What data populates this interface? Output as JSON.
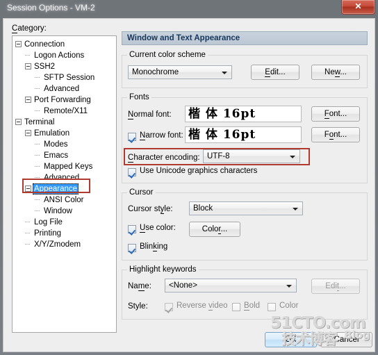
{
  "window": {
    "title": "Session Options - VM-2",
    "close_glyph": "✕"
  },
  "category": {
    "label": "Category:",
    "tree": [
      {
        "text": "Connection",
        "depth": 0,
        "expander": true,
        "selected": false
      },
      {
        "text": "Logon Actions",
        "depth": 1,
        "expander": false,
        "selected": false
      },
      {
        "text": "SSH2",
        "depth": 1,
        "expander": true,
        "selected": false
      },
      {
        "text": "SFTP Session",
        "depth": 2,
        "expander": false,
        "selected": false
      },
      {
        "text": "Advanced",
        "depth": 2,
        "expander": false,
        "selected": false
      },
      {
        "text": "Port Forwarding",
        "depth": 1,
        "expander": true,
        "selected": false
      },
      {
        "text": "Remote/X11",
        "depth": 2,
        "expander": false,
        "selected": false
      },
      {
        "text": "Terminal",
        "depth": 0,
        "expander": true,
        "selected": false
      },
      {
        "text": "Emulation",
        "depth": 1,
        "expander": true,
        "selected": false
      },
      {
        "text": "Modes",
        "depth": 2,
        "expander": false,
        "selected": false
      },
      {
        "text": "Emacs",
        "depth": 2,
        "expander": false,
        "selected": false
      },
      {
        "text": "Mapped Keys",
        "depth": 2,
        "expander": false,
        "selected": false
      },
      {
        "text": "Advanced",
        "depth": 2,
        "expander": false,
        "selected": false
      },
      {
        "text": "Appearance",
        "depth": 1,
        "expander": true,
        "selected": true
      },
      {
        "text": "ANSI Color",
        "depth": 2,
        "expander": false,
        "selected": false
      },
      {
        "text": "Window",
        "depth": 2,
        "expander": false,
        "selected": false
      },
      {
        "text": "Log File",
        "depth": 1,
        "expander": false,
        "selected": false
      },
      {
        "text": "Printing",
        "depth": 1,
        "expander": false,
        "selected": false
      },
      {
        "text": "X/Y/Zmodem",
        "depth": 1,
        "expander": false,
        "selected": false
      }
    ]
  },
  "pane": {
    "header": "Window and Text Appearance",
    "color_scheme": {
      "group_label": "Current color scheme",
      "value": "Monochrome",
      "edit_button": "Edit...",
      "new_button": "New..."
    },
    "fonts": {
      "group_label": "Fonts",
      "normal_font_label": "Normal font:",
      "normal_font_sample": "楷 体  16pt",
      "normal_font_button": "Font...",
      "narrow_font_label": "Narrow font:",
      "narrow_font_sample": "楷 体  16pt",
      "narrow_font_button": "Font...",
      "narrow_font_checked": true,
      "encoding_label": "Character encoding:",
      "encoding_value": "UTF-8",
      "unicode_graphics_label": "Use Unicode graphics characters",
      "unicode_graphics_checked": true
    },
    "cursor": {
      "group_label": "Cursor",
      "style_label": "Cursor style:",
      "style_value": "Block",
      "use_color_label": "Use color:",
      "use_color_checked": true,
      "color_button": "Color...",
      "blinking_label": "Blinking",
      "blinking_checked": true
    },
    "highlight": {
      "group_label": "Highlight keywords",
      "name_label": "Name:",
      "name_value": "<None>",
      "edit_button": "Edit...",
      "style_label": "Style:",
      "reverse_video_label": "Reverse video",
      "reverse_video_checked": true,
      "bold_label": "Bold",
      "bold_checked": false,
      "color_label": "Color",
      "color_checked": false
    }
  },
  "footer": {
    "ok_button": "OK",
    "cancel_button": "Cancel"
  },
  "watermark": {
    "site": "51CTO.com",
    "chinese": "技术博客",
    "blog": "Blog"
  },
  "colors": {
    "title_bar": "#70757a",
    "close_button": "#c64a38",
    "selection": "#3399ff",
    "annotation": "#b03a2e",
    "pane_header": "#bcc7d4"
  }
}
